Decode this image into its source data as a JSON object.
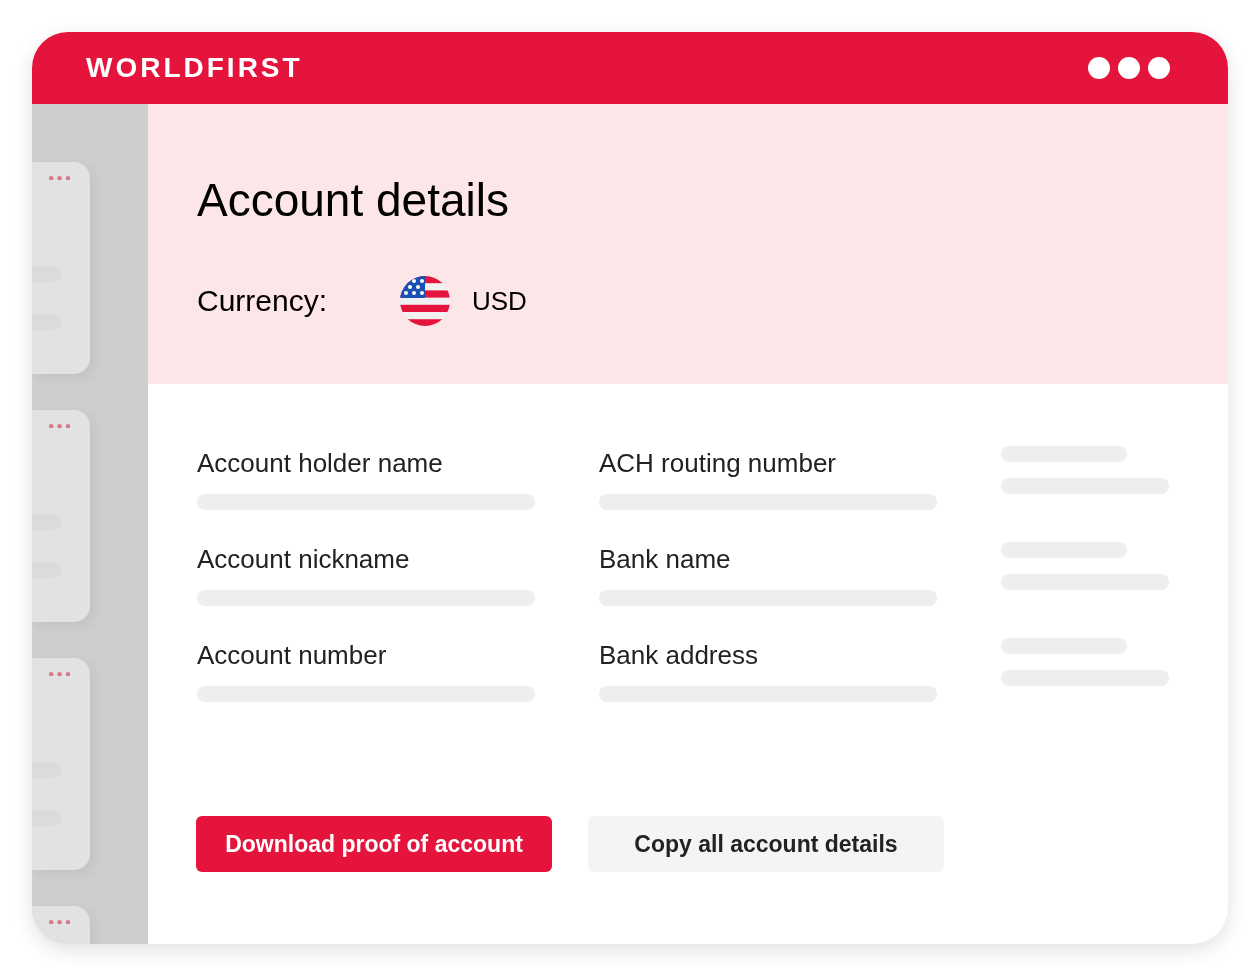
{
  "header": {
    "brand": "WORLDFIRST"
  },
  "panel": {
    "title": "Account details",
    "currency_label": "Currency:",
    "currency": "USD"
  },
  "fields": [
    {
      "label": "Account holder name"
    },
    {
      "label": "ACH routing number"
    },
    {
      "label": "Account nickname"
    },
    {
      "label": "Bank name"
    },
    {
      "label": "Account number"
    },
    {
      "label": "Bank address"
    }
  ],
  "buttons": [
    {
      "label": "Download proof of account",
      "kind": "primary"
    },
    {
      "label": "Copy all account details",
      "kind": "secondary"
    }
  ]
}
